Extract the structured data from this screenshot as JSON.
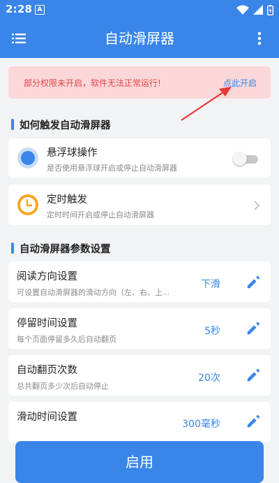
{
  "status_bar": {
    "time": "2:28",
    "notif_letter": "A"
  },
  "app_bar": {
    "title": "自动滑屏器"
  },
  "warning": {
    "message": "部分权限未开启，软件无法正常运行!",
    "link": "点此开启"
  },
  "trigger_section": {
    "title": "如何触发自动滑屏器",
    "items": [
      {
        "title": "悬浮球操作",
        "subtitle": "是否使用悬浮球开启或停止自动滑屏器"
      },
      {
        "title": "定时触发",
        "subtitle": "定时时间开启或停止自动滑屏器"
      }
    ]
  },
  "params_section": {
    "title": "自动滑屏器参数设置",
    "items": [
      {
        "title": "阅读方向设置",
        "subtitle": "可设置自动滑屏器的滑动方向（左、右、上...",
        "value": "下滑"
      },
      {
        "title": "停留时间设置",
        "subtitle": "每个页面停留多久后自动翻页",
        "value": "5秒"
      },
      {
        "title": "自动翻页次数",
        "subtitle": "总共翻页多少次后自动停止",
        "value": "20次"
      },
      {
        "title": "滑动时间设置",
        "subtitle": "",
        "value": "300毫秒"
      }
    ]
  },
  "primary_button": {
    "label": "启用"
  },
  "colors": {
    "primary": "#3a86e8",
    "warning_bg": "#fbd7da",
    "warning_text": "#e24545",
    "arrow": "#e53935"
  }
}
